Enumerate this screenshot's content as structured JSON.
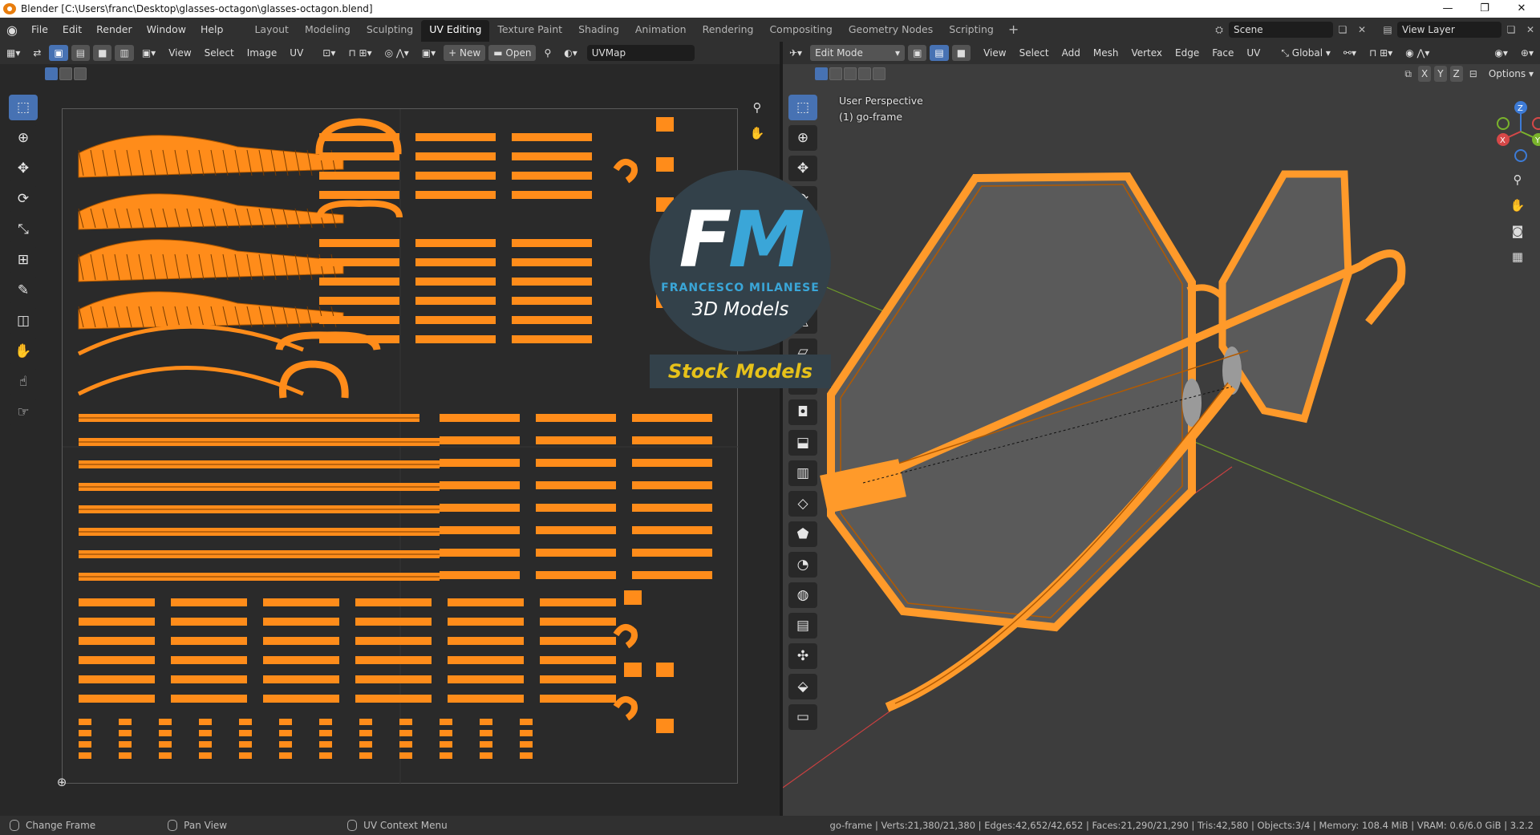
{
  "window": {
    "title": "Blender [C:\\Users\\franc\\Desktop\\glasses-octagon\\glasses-octagon.blend]",
    "minimize": "—",
    "maximize": "❐",
    "close": "✕"
  },
  "menubar": {
    "items": [
      "File",
      "Edit",
      "Render",
      "Window",
      "Help"
    ]
  },
  "workspaces": {
    "tabs": [
      "Layout",
      "Modeling",
      "Sculpting",
      "UV Editing",
      "Texture Paint",
      "Shading",
      "Animation",
      "Rendering",
      "Compositing",
      "Geometry Nodes",
      "Scripting"
    ],
    "active": "UV Editing",
    "add": "+"
  },
  "scene": {
    "scene_name": "Scene",
    "view_layer": "View Layer"
  },
  "uv_editor": {
    "menus": [
      "View",
      "Select",
      "Image",
      "UV"
    ],
    "new_label": "New",
    "open_label": "Open",
    "uvmap": "UVMap"
  },
  "viewport": {
    "mode": "Edit Mode",
    "menus": [
      "View",
      "Select",
      "Add",
      "Mesh",
      "Vertex",
      "Edge",
      "Face",
      "UV"
    ],
    "orientation": "Global",
    "axes": [
      "X",
      "Y",
      "Z"
    ],
    "options": "Options",
    "info_line1": "User Perspective",
    "info_line2": "(1) go-frame",
    "gizmo": {
      "x": "X",
      "y": "Y",
      "z": "Z"
    }
  },
  "watermark": {
    "letters_f": "F",
    "letters_m": "M",
    "name": "FRANCESCO MILANESE",
    "subtitle": "3D Models",
    "stock": "Stock Models"
  },
  "statusbar": {
    "left1": "Change Frame",
    "left2": "Pan View",
    "left3": "UV Context Menu",
    "stats": "go-frame | Verts:21,380/21,380 | Edges:42,652/42,652 | Faces:21,290/21,290 | Tris:42,580 | Objects:3/4 | Memory: 108.4 MiB | VRAM: 0.6/6.0 GiB | 3.2.2"
  },
  "colors": {
    "accent": "#4772b3",
    "uv_orange": "#ff8c1a",
    "mesh_orange": "#ff9a2a"
  }
}
